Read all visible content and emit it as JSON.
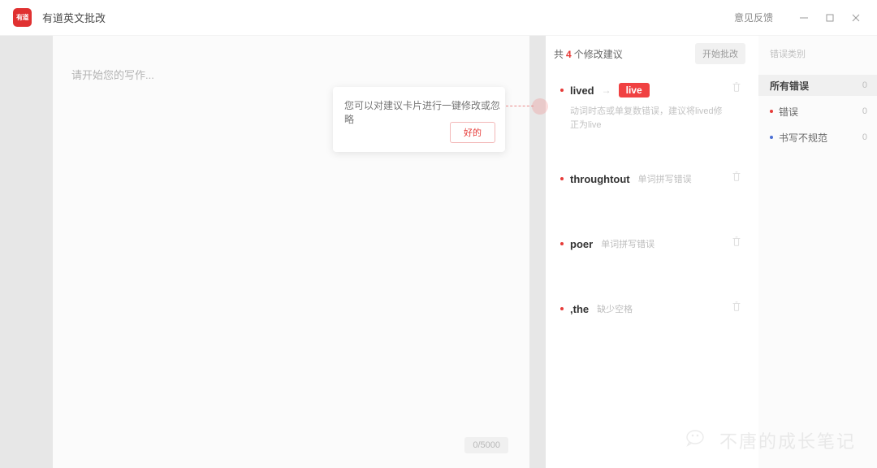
{
  "titlebar": {
    "logo_text": "有道",
    "app_title": "有道英文批改",
    "feedback_label": "意见反馈",
    "minimize_icon": "minimize-icon",
    "maximize_icon": "maximize-icon",
    "close_icon": "close-icon"
  },
  "editor": {
    "placeholder": "请开始您的写作...",
    "char_counter": "0/5000"
  },
  "suggestions": {
    "header_prefix": "共",
    "header_count": "4",
    "header_suffix": "个修改建议",
    "start_button": "开始批改",
    "cards": [
      {
        "word": "lived",
        "arrow": "→",
        "fix": "live",
        "type": "",
        "description": "动词时态或单复数错误，建议将lived修正为live",
        "delete_icon": "trash-icon"
      },
      {
        "word": "throughtout",
        "arrow": "",
        "fix": "",
        "type": "单词拼写错误",
        "description": "",
        "delete_icon": "trash-icon"
      },
      {
        "word": "poer",
        "arrow": "",
        "fix": "",
        "type": "单词拼写错误",
        "description": "",
        "delete_icon": "trash-icon"
      },
      {
        "word": ",the",
        "arrow": "",
        "fix": "",
        "type": "缺少空格",
        "description": "",
        "delete_icon": "trash-icon"
      }
    ]
  },
  "categories": {
    "title": "错误类别",
    "items": [
      {
        "label": "所有错误",
        "count": "0",
        "dot": "none"
      },
      {
        "label": "错误",
        "count": "0",
        "dot": "red"
      },
      {
        "label": "书写不规范",
        "count": "0",
        "dot": "blue"
      }
    ]
  },
  "tooltip": {
    "text": "您可以对建议卡片进行一键修改或忽略",
    "ok_label": "好的"
  },
  "watermark": {
    "text": "不唐的成长笔记",
    "icon": "wechat-icon"
  },
  "colors": {
    "accent_red": "#e63b38",
    "badge_red": "#f04142",
    "dot_blue": "#4a6fd4",
    "panel_gray": "#e7e7e7"
  }
}
